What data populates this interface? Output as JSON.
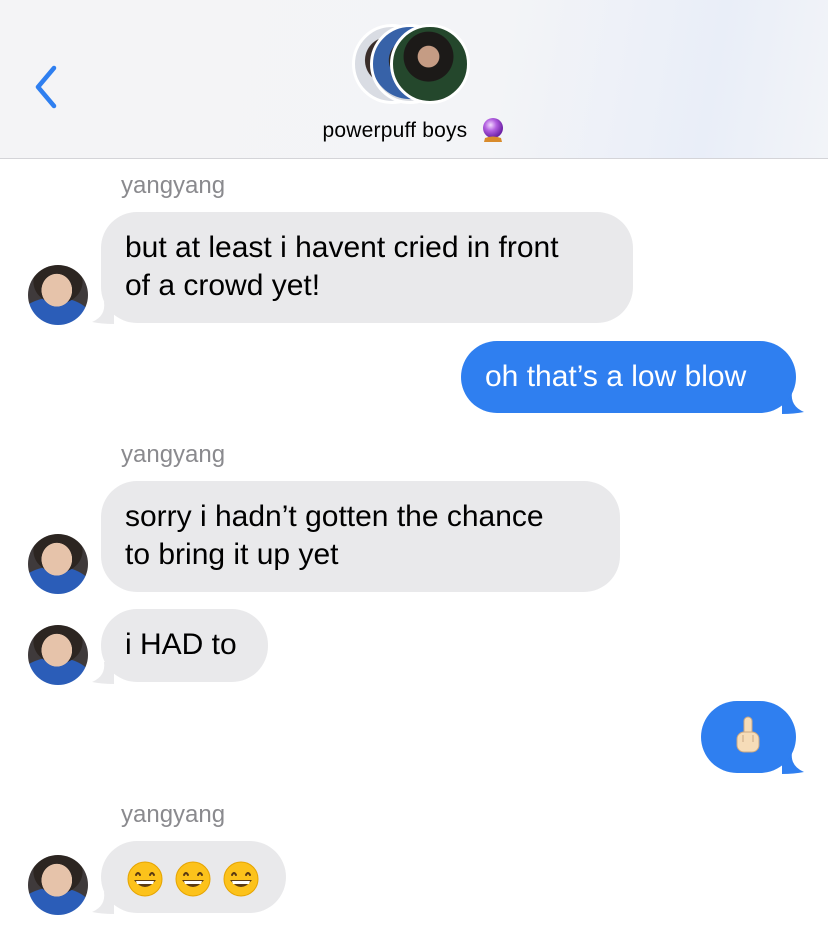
{
  "header": {
    "back_icon": "chevron-left-icon",
    "group_name": "powerpuff boys",
    "group_emoji_icon": "crystal-ball-icon",
    "accent_color": "#2f7ff0"
  },
  "messages": [
    {
      "direction": "incoming",
      "sender": "yangyang",
      "lines": [
        "but at least i havent cried in front",
        "of a crowd yet!"
      ]
    },
    {
      "direction": "outgoing",
      "lines": [
        "oh that’s a low blow"
      ]
    },
    {
      "direction": "incoming",
      "sender": "yangyang",
      "lines": [
        "sorry i hadn’t gotten the chance",
        "to bring it up yet"
      ]
    },
    {
      "direction": "incoming",
      "lines": [
        "i HAD to"
      ]
    },
    {
      "direction": "outgoing",
      "emoji": "middle-finger-emoji-icon"
    },
    {
      "direction": "incoming",
      "sender": "yangyang",
      "emoji": [
        "grinning-face-emoji-icon",
        "grinning-face-emoji-icon",
        "grinning-face-emoji-icon"
      ]
    }
  ],
  "colors": {
    "incoming_bubble": "#e9e9eb",
    "outgoing_bubble": "#2f7ff0",
    "sender_label": "#8a8a8e"
  }
}
